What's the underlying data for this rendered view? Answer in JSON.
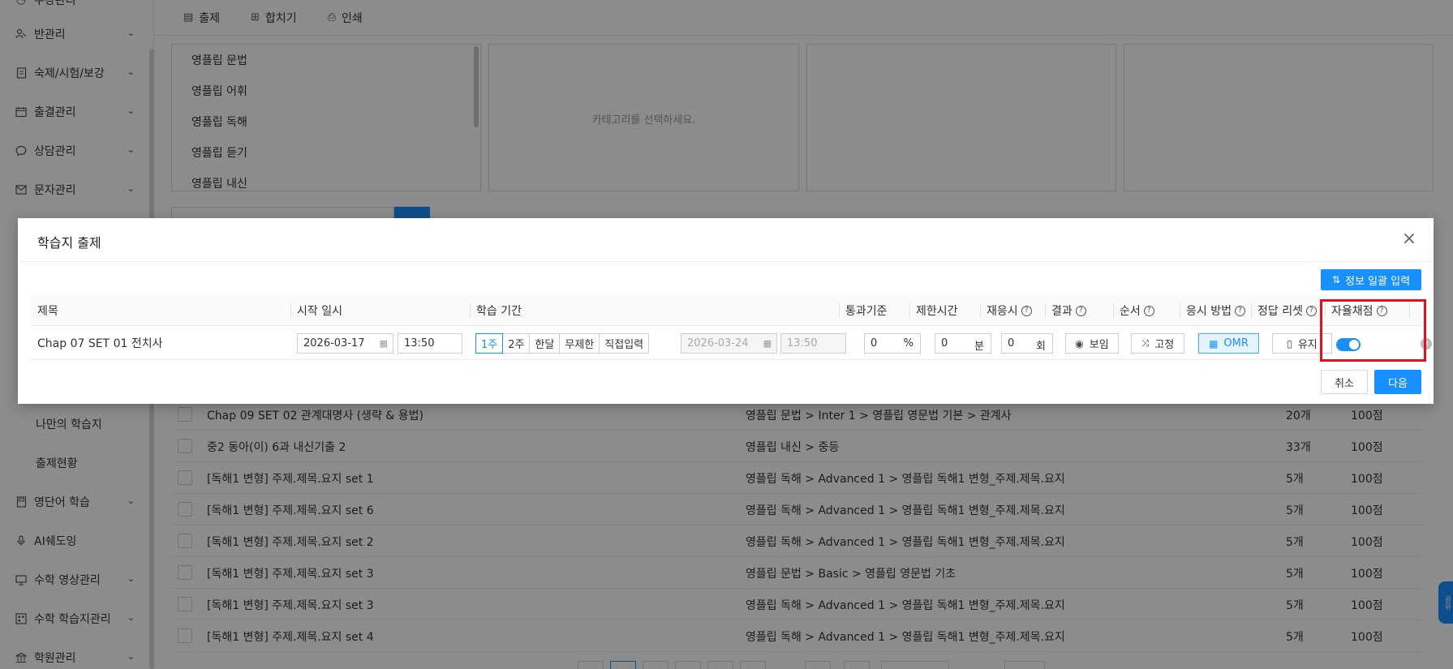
{
  "sidebar": {
    "top_partial": "수강관리",
    "items": [
      {
        "label": "반관리",
        "icon": "class-group-icon"
      },
      {
        "label": "숙제/시험/보강",
        "icon": "document-icon"
      },
      {
        "label": "출결관리",
        "icon": "calendar-icon"
      },
      {
        "label": "상담관리",
        "icon": "chat-icon"
      },
      {
        "label": "문자관리",
        "icon": "mail-icon"
      }
    ],
    "sub_items": [
      "나만의 학습지",
      "출제현황"
    ],
    "bottom_items": [
      {
        "label": "영단어 학습",
        "icon": "book-icon"
      },
      {
        "label": "AI쉐도잉",
        "icon": "microphone-icon"
      },
      {
        "label": "수학 영상관리",
        "icon": "monitor-icon"
      },
      {
        "label": "수학 학습지관리",
        "icon": "grid-icon"
      },
      {
        "label": "학원관리",
        "icon": "building-icon"
      }
    ]
  },
  "toolbar": {
    "assign_label": "출제",
    "merge_label": "합치기",
    "print_label": "인쇄"
  },
  "categories": {
    "items": [
      "영플립 문법",
      "영플립 어휘",
      "영플립 독해",
      "영플립 듣기",
      "영플립 내신"
    ],
    "empty_message": "카테고리를 선택하세요."
  },
  "bg_table": {
    "rows": [
      {
        "title": "Chap 09 SET 02 관계대명사 (생략 & 용법)",
        "path": "영플립 문법 > Inter 1 > 영플립 영문법 기본 > 관계사",
        "count": "20개",
        "score": "100점"
      },
      {
        "title": "중2 동아(이) 6과 내신기출 2",
        "path": "영플립 내신 > 중등",
        "count": "33개",
        "score": "100점"
      },
      {
        "title": "[독해1 변형] 주제.제목.요지 set 1",
        "path": "영플립 독해 > Advanced 1 > 영플립 독해1 변형_주제.제목.요지",
        "count": "5개",
        "score": "100점"
      },
      {
        "title": "[독해1 변형] 주제.제목.요지 set 6",
        "path": "영플립 독해 > Advanced 1 > 영플립 독해1 변형_주제.제목.요지",
        "count": "5개",
        "score": "100점"
      },
      {
        "title": "[독해1 변형] 주제.제목.요지 set 2",
        "path": "영플립 독해 > Advanced 1 > 영플립 독해1 변형_주제.제목.요지",
        "count": "5개",
        "score": "100점"
      },
      {
        "title": "[독해1 변형] 주제.제목.요지 set 3",
        "path": "영플립 문법 > Basic > 영플립 영문법 기초",
        "count": "5개",
        "score": "100점"
      },
      {
        "title": "[독해1 변형] 주제.제목.요지 set 3",
        "path": "영플립 독해 > Advanced 1 > 영플립 독해1 변형_주제.제목.요지",
        "count": "5개",
        "score": "100점"
      },
      {
        "title": "[독해1 변형] 주제.제목.요지 set 4",
        "path": "영플립 독해 > Advanced 1 > 영플립 독해1 변형_주제.제목.요지",
        "count": "5개",
        "score": "100점"
      }
    ]
  },
  "modal": {
    "title": "학습지 출제",
    "bulk_input_label": "정보 일괄 입력",
    "columns": {
      "title": "제목",
      "start": "시작 일시",
      "period": "학습 기간",
      "pass": "통과기준",
      "time_limit": "제한시간",
      "retake": "재응시",
      "result": "결과",
      "order": "순서",
      "method": "응시 방법",
      "answer_reset": "정답 리셋",
      "auto_grade": "자율채점"
    },
    "row": {
      "title": "Chap 07 SET 01 전치사",
      "start_date": "2026-03-17",
      "start_time": "13:50",
      "period_options": [
        "1주",
        "2주",
        "한달",
        "무제한",
        "직접입력"
      ],
      "period_selected": "1주",
      "end_date": "2026-03-24",
      "end_time": "13:50",
      "pass_value": "0",
      "pass_unit": "%",
      "time_value": "0",
      "time_unit": "분",
      "retake_value": "0",
      "retake_unit": "회",
      "result_label": "보임",
      "order_label": "고정",
      "method_label": "OMR",
      "reset_label": "유지",
      "auto_grade_on": true
    },
    "cancel_label": "취소",
    "next_label": "다음"
  },
  "float_tab_label": "공유",
  "colors": {
    "primary": "#1890ff",
    "highlight": "#e0121f"
  }
}
